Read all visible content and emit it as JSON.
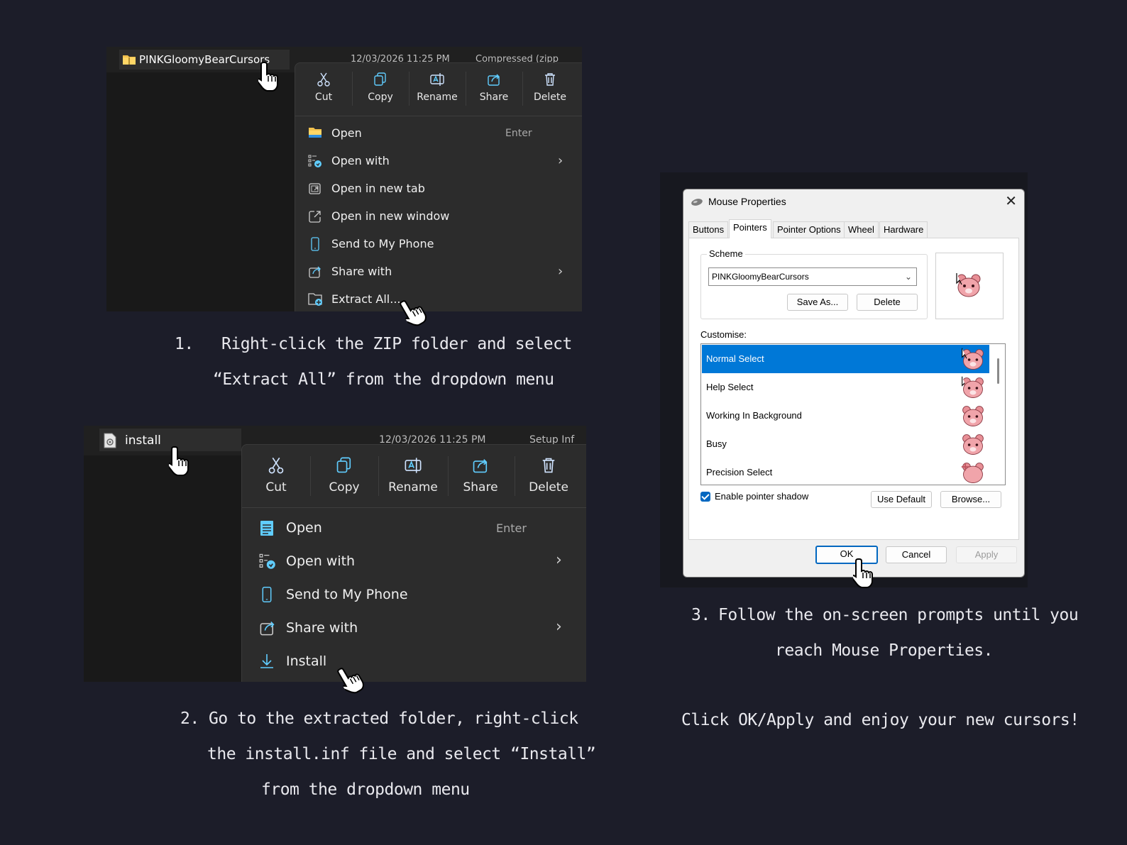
{
  "step1": {
    "file_name": "PINKGloomyBearCursors",
    "file_date": "12/03/2026 11:25 PM",
    "file_type": "Compressed (zipp",
    "toolbar": [
      "Cut",
      "Copy",
      "Rename",
      "Share",
      "Delete"
    ],
    "menu": [
      {
        "label": "Open",
        "shortcut": "Enter",
        "icon": "folder-icon",
        "submenu": false
      },
      {
        "label": "Open with",
        "shortcut": "",
        "icon": "open-with-icon",
        "submenu": true
      },
      {
        "label": "Open in new tab",
        "shortcut": "",
        "icon": "new-tab-icon",
        "submenu": false
      },
      {
        "label": "Open in new window",
        "shortcut": "",
        "icon": "new-window-icon",
        "submenu": false
      },
      {
        "label": "Send to My Phone",
        "shortcut": "",
        "icon": "phone-icon",
        "submenu": false
      },
      {
        "label": "Share with",
        "shortcut": "",
        "icon": "share-with-icon",
        "submenu": true
      },
      {
        "label": "Extract All...",
        "shortcut": "",
        "icon": "extract-icon",
        "submenu": false
      }
    ],
    "caption_num": "1.",
    "caption_line1": "Right-click the ZIP folder and select",
    "caption_line2": "“Extract All” from the dropdown menu"
  },
  "step2": {
    "file_name": "install",
    "file_date": "12/03/2026 11:25 PM",
    "file_type": "Setup Inf",
    "toolbar": [
      "Cut",
      "Copy",
      "Rename",
      "Share",
      "Delete"
    ],
    "menu": [
      {
        "label": "Open",
        "shortcut": "Enter",
        "icon": "notepad-icon",
        "submenu": false
      },
      {
        "label": "Open with",
        "shortcut": "",
        "icon": "open-with-icon",
        "submenu": true
      },
      {
        "label": "Send to My Phone",
        "shortcut": "",
        "icon": "phone-icon",
        "submenu": false
      },
      {
        "label": "Share with",
        "shortcut": "",
        "icon": "share-with-icon",
        "submenu": true
      },
      {
        "label": "Install",
        "shortcut": "",
        "icon": "install-icon",
        "submenu": false
      }
    ],
    "caption_line1": "2.  Go to the extracted folder, right-click",
    "caption_line2": "the install.inf file and select “Install”",
    "caption_line3": "from the dropdown menu"
  },
  "step3": {
    "caption_num": "3.",
    "caption_line1": "Follow the on-screen prompts until you",
    "caption_line2": "reach Mouse Properties.",
    "final_line": "Click OK/Apply and enjoy your new cursors!"
  },
  "dialog": {
    "title": "Mouse Properties",
    "tabs": [
      "Buttons",
      "Pointers",
      "Pointer Options",
      "Wheel",
      "Hardware"
    ],
    "active_tab": "Pointers",
    "scheme_label": "Scheme",
    "scheme_value": "PINKGloomyBearCursors",
    "save_as": "Save As...",
    "delete": "Delete",
    "customise_label": "Customise:",
    "pointers": [
      "Normal Select",
      "Help Select",
      "Working In Background",
      "Busy",
      "Precision Select"
    ],
    "shadow_label": "Enable pointer shadow",
    "use_default": "Use Default",
    "browse": "Browse...",
    "ok": "OK",
    "cancel": "Cancel",
    "apply": "Apply",
    "accent": "#0078d7"
  },
  "colors": {
    "background": "#1c1d29",
    "menu": "#2c2c2c",
    "icon_blue": "#60cdff",
    "bear_pink": "#e88f96"
  }
}
